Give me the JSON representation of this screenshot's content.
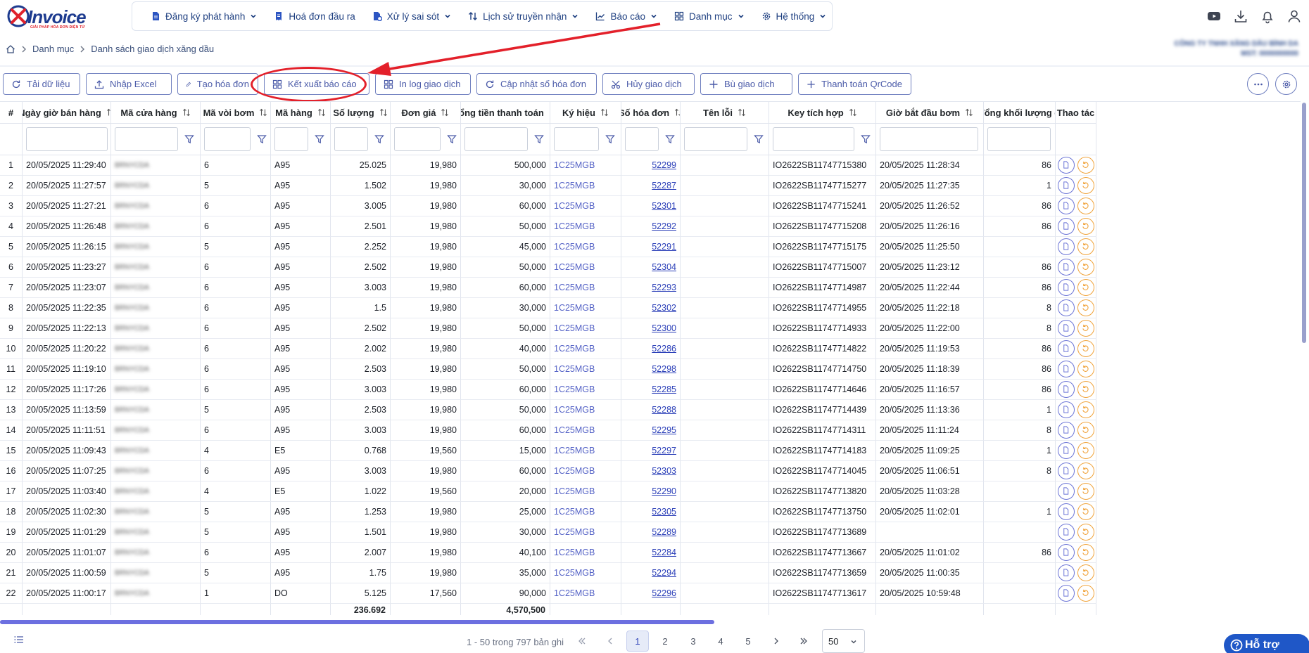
{
  "logo": {
    "brand": "Invoice",
    "tagline": "GIẢI PHÁP HÓA ĐƠN ĐIỆN TỬ"
  },
  "nav": [
    {
      "label": "Đăng ký phát hành",
      "icon": "document-icon",
      "has_menu": true
    },
    {
      "label": "Hoá đơn đầu ra",
      "icon": "invoice-icon",
      "has_menu": false
    },
    {
      "label": "Xử lý sai sót",
      "icon": "fix-document-icon",
      "has_menu": true
    },
    {
      "label": "Lịch sử truyền nhận",
      "icon": "transfer-arrows-icon",
      "has_menu": true
    },
    {
      "label": "Báo cáo",
      "icon": "chart-icon",
      "has_menu": true
    },
    {
      "label": "Danh mục",
      "icon": "grid-icon",
      "has_menu": true
    },
    {
      "label": "Hệ thống",
      "icon": "gear-icon",
      "has_menu": true
    }
  ],
  "top_icons": [
    "youtube-icon",
    "download-icon",
    "bell-icon",
    "user-icon"
  ],
  "breadcrumb": {
    "items": [
      "Danh mục",
      "Danh sách giao dịch xăng dầu"
    ]
  },
  "company": {
    "name": "CÔNG TY TNHH XĂNG DẦU BÌNH DA",
    "tax": "MST: 0000000000"
  },
  "toolbar": {
    "reload": "Tải dữ liệu",
    "import_excel": "Nhập Excel",
    "create_invoice": "Tạo hóa đơn",
    "export_report": "Kết xuất báo cáo",
    "print_log": "In log giao dịch",
    "update_invoice_no": "Cập nhật số hóa đơn",
    "cancel_txn": "Hủy giao dịch",
    "supplement_txn": "Bù giao dịch",
    "qr_payment": "Thanh toán QrCode"
  },
  "columns": [
    "#",
    "Ngày giờ bán hàng",
    "Mã cửa hàng",
    "Mã vòi bơm",
    "Mã hàng",
    "Số lượng",
    "Đơn giá",
    "Tổng tiền thanh toán",
    "Ký hiệu",
    "Số hóa đơn",
    "Tên lỗi",
    "Key tích hợp",
    "Giờ bắt đầu bơm",
    "Tổng khối lượng đ",
    "Thao tác"
  ],
  "rows": [
    [
      "1",
      "20/05/2025 11:29:40",
      "BRNYCDA",
      "6",
      "A95",
      "25.025",
      "19,980",
      "500,000",
      "1C25MGB",
      "52299",
      "",
      "IO2622SB11747715380",
      "20/05/2025 11:28:34",
      "86"
    ],
    [
      "2",
      "20/05/2025 11:27:57",
      "BRNYCDA",
      "5",
      "A95",
      "1.502",
      "19,980",
      "30,000",
      "1C25MGB",
      "52287",
      "",
      "IO2622SB11747715277",
      "20/05/2025 11:27:35",
      "1"
    ],
    [
      "3",
      "20/05/2025 11:27:21",
      "BRNYCDA",
      "6",
      "A95",
      "3.005",
      "19,980",
      "60,000",
      "1C25MGB",
      "52301",
      "",
      "IO2622SB11747715241",
      "20/05/2025 11:26:52",
      "86"
    ],
    [
      "4",
      "20/05/2025 11:26:48",
      "BRNYCDA",
      "6",
      "A95",
      "2.501",
      "19,980",
      "50,000",
      "1C25MGB",
      "52292",
      "",
      "IO2622SB11747715208",
      "20/05/2025 11:26:16",
      "86"
    ],
    [
      "5",
      "20/05/2025 11:26:15",
      "BRNYCDA",
      "5",
      "A95",
      "2.252",
      "19,980",
      "45,000",
      "1C25MGB",
      "52291",
      "",
      "IO2622SB11747715175",
      "20/05/2025 11:25:50",
      ""
    ],
    [
      "6",
      "20/05/2025 11:23:27",
      "BRNYCDA",
      "6",
      "A95",
      "2.502",
      "19,980",
      "50,000",
      "1C25MGB",
      "52304",
      "",
      "IO2622SB11747715007",
      "20/05/2025 11:23:12",
      "86"
    ],
    [
      "7",
      "20/05/2025 11:23:07",
      "BRNYCDA",
      "6",
      "A95",
      "3.003",
      "19,980",
      "60,000",
      "1C25MGB",
      "52293",
      "",
      "IO2622SB11747714987",
      "20/05/2025 11:22:44",
      "86"
    ],
    [
      "8",
      "20/05/2025 11:22:35",
      "BRNYCDA",
      "6",
      "A95",
      "1.5",
      "19,980",
      "30,000",
      "1C25MGB",
      "52302",
      "",
      "IO2622SB11747714955",
      "20/05/2025 11:22:18",
      "8"
    ],
    [
      "9",
      "20/05/2025 11:22:13",
      "BRNYCDA",
      "6",
      "A95",
      "2.502",
      "19,980",
      "50,000",
      "1C25MGB",
      "52300",
      "",
      "IO2622SB11747714933",
      "20/05/2025 11:22:00",
      "8"
    ],
    [
      "10",
      "20/05/2025 11:20:22",
      "BRNYCDA",
      "6",
      "A95",
      "2.002",
      "19,980",
      "40,000",
      "1C25MGB",
      "52286",
      "",
      "IO2622SB11747714822",
      "20/05/2025 11:19:53",
      "86"
    ],
    [
      "11",
      "20/05/2025 11:19:10",
      "BRNYCDA",
      "6",
      "A95",
      "2.503",
      "19,980",
      "50,000",
      "1C25MGB",
      "52298",
      "",
      "IO2622SB11747714750",
      "20/05/2025 11:18:39",
      "86"
    ],
    [
      "12",
      "20/05/2025 11:17:26",
      "BRNYCDA",
      "6",
      "A95",
      "3.003",
      "19,980",
      "60,000",
      "1C25MGB",
      "52285",
      "",
      "IO2622SB11747714646",
      "20/05/2025 11:16:57",
      "86"
    ],
    [
      "13",
      "20/05/2025 11:13:59",
      "BRNYCDA",
      "5",
      "A95",
      "2.503",
      "19,980",
      "50,000",
      "1C25MGB",
      "52288",
      "",
      "IO2622SB11747714439",
      "20/05/2025 11:13:36",
      "1"
    ],
    [
      "14",
      "20/05/2025 11:11:51",
      "BRNYCDA",
      "6",
      "A95",
      "3.003",
      "19,980",
      "60,000",
      "1C25MGB",
      "52295",
      "",
      "IO2622SB11747714311",
      "20/05/2025 11:11:24",
      "8"
    ],
    [
      "15",
      "20/05/2025 11:09:43",
      "BRNYCDA",
      "4",
      "E5",
      "0.768",
      "19,560",
      "15,000",
      "1C25MGB",
      "52297",
      "",
      "IO2622SB11747714183",
      "20/05/2025 11:09:25",
      "1"
    ],
    [
      "16",
      "20/05/2025 11:07:25",
      "BRNYCDA",
      "6",
      "A95",
      "3.003",
      "19,980",
      "60,000",
      "1C25MGB",
      "52303",
      "",
      "IO2622SB11747714045",
      "20/05/2025 11:06:51",
      "8"
    ],
    [
      "17",
      "20/05/2025 11:03:40",
      "BRNYCDA",
      "4",
      "E5",
      "1.022",
      "19,560",
      "20,000",
      "1C25MGB",
      "52290",
      "",
      "IO2622SB11747713820",
      "20/05/2025 11:03:28",
      ""
    ],
    [
      "18",
      "20/05/2025 11:02:30",
      "BRNYCDA",
      "5",
      "A95",
      "1.253",
      "19,980",
      "25,000",
      "1C25MGB",
      "52305",
      "",
      "IO2622SB11747713750",
      "20/05/2025 11:02:01",
      "1"
    ],
    [
      "19",
      "20/05/2025 11:01:29",
      "BRNYCDA",
      "5",
      "A95",
      "1.501",
      "19,980",
      "30,000",
      "1C25MGB",
      "52289",
      "",
      "IO2622SB11747713689",
      "",
      ""
    ],
    [
      "20",
      "20/05/2025 11:01:07",
      "BRNYCDA",
      "6",
      "A95",
      "2.007",
      "19,980",
      "40,100",
      "1C25MGB",
      "52284",
      "",
      "IO2622SB11747713667",
      "20/05/2025 11:01:02",
      "86"
    ],
    [
      "21",
      "20/05/2025 11:00:59",
      "BRNYCDA",
      "5",
      "A95",
      "1.75",
      "19,980",
      "35,000",
      "1C25MGB",
      "52294",
      "",
      "IO2622SB11747713659",
      "20/05/2025 11:00:35",
      ""
    ],
    [
      "22",
      "20/05/2025 11:00:17",
      "BRNYCDA",
      "1",
      "DO",
      "5.125",
      "17,560",
      "90,000",
      "1C25MGB",
      "52296",
      "",
      "IO2622SB11747713617",
      "20/05/2025 10:59:48",
      ""
    ]
  ],
  "totals": {
    "quantity": "236.692",
    "amount": "4,570,500"
  },
  "pager": {
    "info": "1 - 50 trong 797 bản ghi",
    "pages": [
      "1",
      "2",
      "3",
      "4",
      "5"
    ],
    "current": "1",
    "page_size": "50"
  },
  "help": {
    "label": "Hỗ trợ"
  },
  "colors": {
    "primary": "#1e3f80",
    "accent": "#5462c6",
    "annotation": "#e3202a",
    "orange": "#f0a33b"
  }
}
